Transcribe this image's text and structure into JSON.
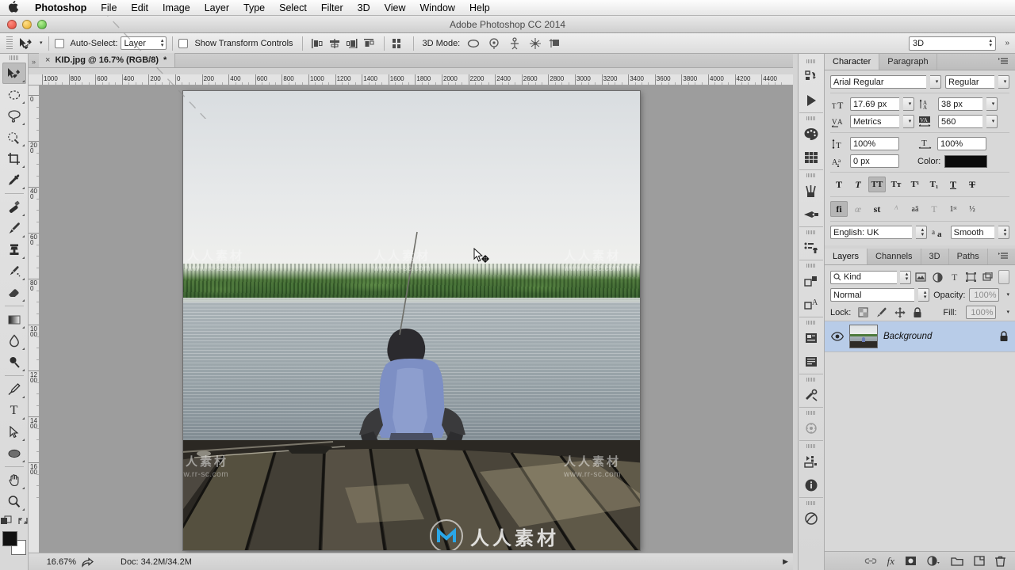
{
  "app": {
    "title": "Adobe Photoshop CC 2014"
  },
  "menubar": {
    "apple_icon": "apple-icon",
    "items": [
      {
        "label": "Photoshop",
        "bold": true
      },
      {
        "label": "File",
        "bold": false
      },
      {
        "label": "Edit",
        "bold": false
      },
      {
        "label": "Image",
        "bold": false
      },
      {
        "label": "Layer",
        "bold": false
      },
      {
        "label": "Type",
        "bold": false
      },
      {
        "label": "Select",
        "bold": false
      },
      {
        "label": "Filter",
        "bold": false
      },
      {
        "label": "3D",
        "bold": false
      },
      {
        "label": "View",
        "bold": false
      },
      {
        "label": "Window",
        "bold": false
      },
      {
        "label": "Help",
        "bold": false
      }
    ]
  },
  "options_bar": {
    "tool_icon": "move-tool-icon",
    "auto_select_label": "Auto-Select:",
    "auto_select_checked": false,
    "auto_select_target": "Layer",
    "show_transform_label": "Show Transform Controls",
    "show_transform_checked": false,
    "mode_3d_label": "3D Mode:",
    "workspace": "3D",
    "align_icons": [
      "align-left-edges-icon",
      "align-horizontal-centers-icon",
      "align-right-edges-icon",
      "align-top-edges-icon",
      "distribute-icon"
    ],
    "mode_3d_icons": [
      "rotate-3d-icon",
      "roll-3d-icon",
      "drag-3d-icon",
      "slide-3d-icon",
      "scale-3d-icon"
    ]
  },
  "toolbar": {
    "tools": [
      {
        "name": "move-tool",
        "icon": "move-tool-icon",
        "active": true
      },
      {
        "name": "marquee-tool",
        "icon": "elliptical-marquee-icon",
        "active": false
      },
      {
        "name": "lasso-tool",
        "icon": "lasso-icon",
        "active": false
      },
      {
        "name": "quick-selection-tool",
        "icon": "quick-selection-icon",
        "active": false
      },
      {
        "name": "crop-tool",
        "icon": "crop-icon",
        "active": false
      },
      {
        "name": "eyedropper-tool",
        "icon": "eyedropper-icon",
        "active": false
      },
      {
        "name": "healing-brush-tool",
        "icon": "healing-brush-icon",
        "active": false
      },
      {
        "name": "brush-tool",
        "icon": "brush-icon",
        "active": false
      },
      {
        "name": "clone-stamp-tool",
        "icon": "clone-stamp-icon",
        "active": false
      },
      {
        "name": "history-brush-tool",
        "icon": "history-brush-icon",
        "active": false
      },
      {
        "name": "eraser-tool",
        "icon": "eraser-icon",
        "active": false
      },
      {
        "name": "gradient-tool",
        "icon": "gradient-icon",
        "active": false
      },
      {
        "name": "blur-tool",
        "icon": "blur-droplet-icon",
        "active": false
      },
      {
        "name": "dodge-tool",
        "icon": "dodge-icon",
        "active": false
      },
      {
        "name": "pen-tool",
        "icon": "pen-icon",
        "active": false
      },
      {
        "name": "type-tool",
        "icon": "type-icon",
        "active": false
      },
      {
        "name": "path-selection-tool",
        "icon": "path-selection-arrow-icon",
        "active": false
      },
      {
        "name": "ellipse-tool",
        "icon": "ellipse-shape-icon",
        "active": false
      },
      {
        "name": "hand-tool",
        "icon": "hand-icon",
        "active": false
      },
      {
        "name": "zoom-tool",
        "icon": "magnifier-icon",
        "active": false
      }
    ],
    "foreground_color": "#111111",
    "background_color": "#ffffff"
  },
  "document": {
    "tab_label": "KID.jpg @ 16.7% (RGB/8)",
    "modified_marker": "*",
    "close_glyph": "×"
  },
  "rulers": {
    "horizontal": [
      "1000",
      "800",
      "600",
      "400",
      "200",
      "0",
      "200",
      "400",
      "600",
      "800",
      "1000",
      "1200",
      "1400",
      "1600",
      "1800",
      "2000",
      "2200",
      "2400",
      "2600",
      "2800",
      "3000",
      "3200",
      "3400",
      "3600",
      "3800",
      "4000",
      "4200",
      "4400"
    ],
    "vertical": [
      "0",
      "200",
      "400",
      "600",
      "800",
      "1000",
      "1200",
      "1400",
      "1600"
    ]
  },
  "canvas": {
    "watermark_cn": "人人素材",
    "watermark_url": "www.rr-sc.com",
    "cursor": "move-cursor"
  },
  "status_bar": {
    "zoom": "16.67%",
    "share_icon": "share-icon",
    "doc_info": "Doc: 34.2M/34.2M",
    "expand_glyph": "▶"
  },
  "rail": {
    "buttons": [
      "history-icon",
      "actions-play-icon",
      "color-palette-icon",
      "swatches-grid-icon",
      "brushes-icon",
      "brush-presets-icon",
      "clone-source-icon",
      "adjustments-icon",
      "styles-icon",
      "character-styles-icon",
      "paragraph-styles-icon",
      "tool-presets-icon",
      "3d-icon",
      "timeline-icon",
      "info-icon",
      "notes-icon"
    ]
  },
  "character_panel": {
    "tabs": [
      {
        "label": "Character",
        "active": true
      },
      {
        "label": "Paragraph",
        "active": false
      }
    ],
    "menu_icon": "panel-menu-icon",
    "font_family": "Arial Regular",
    "font_style": "Regular",
    "font_size_icon": "font-size-icon",
    "font_size": "17.69 px",
    "leading_icon": "leading-icon",
    "leading": "38 px",
    "kerning_icon": "kerning-icon",
    "kerning": "Metrics",
    "tracking_icon": "tracking-icon",
    "tracking": "560",
    "vertical_scale_icon": "vertical-scale-icon",
    "vertical_scale": "100%",
    "horizontal_scale_icon": "horizontal-scale-icon",
    "horizontal_scale": "100%",
    "baseline_icon": "baseline-shift-icon",
    "baseline_shift": "0 px",
    "color_label": "Color:",
    "text_color": "#0b0b0b",
    "style_buttons": [
      {
        "name": "faux-bold",
        "glyph": "T",
        "on": false
      },
      {
        "name": "faux-italic",
        "glyph": "T",
        "on": false
      },
      {
        "name": "all-caps",
        "glyph": "TT",
        "on": true
      },
      {
        "name": "small-caps",
        "glyph": "Tт",
        "on": false
      },
      {
        "name": "superscript",
        "glyph": "T¹",
        "on": false
      },
      {
        "name": "subscript",
        "glyph": "T₁",
        "on": false
      },
      {
        "name": "underline",
        "glyph": "T",
        "on": false
      },
      {
        "name": "strikethrough",
        "glyph": "T",
        "on": false
      }
    ],
    "opentype_buttons": [
      {
        "name": "standard-ligatures",
        "glyph": "fi",
        "on": true,
        "dim": false
      },
      {
        "name": "contextual-alternates",
        "glyph": "œ",
        "on": false,
        "dim": true
      },
      {
        "name": "discretionary-ligatures",
        "glyph": "st",
        "on": false,
        "dim": false
      },
      {
        "name": "swash",
        "glyph": "ᴬ",
        "on": false,
        "dim": true
      },
      {
        "name": "oldstyle",
        "glyph": "aā",
        "on": false,
        "dim": false
      },
      {
        "name": "titling-alternates",
        "glyph": "T",
        "on": false,
        "dim": true
      },
      {
        "name": "ordinals",
        "glyph": "1ˢᵗ",
        "on": false,
        "dim": false
      },
      {
        "name": "fractions",
        "glyph": "½",
        "on": false,
        "dim": false
      }
    ],
    "language": "English: UK",
    "antialias_icon": "anti-alias-icon",
    "antialias": "Smooth"
  },
  "layers_panel": {
    "tabs": [
      {
        "label": "Layers",
        "active": true
      },
      {
        "label": "Channels",
        "active": false
      },
      {
        "label": "3D",
        "active": false
      },
      {
        "label": "Paths",
        "active": false
      }
    ],
    "menu_icon": "panel-menu-icon",
    "filter_kind": "Kind",
    "filter_icons": [
      "filter-pixel-icon",
      "filter-adjustment-icon",
      "filter-type-icon",
      "filter-shape-icon",
      "filter-smart-object-icon"
    ],
    "filter_toggle_icon": "filter-power-icon",
    "blend_mode": "Normal",
    "opacity_label": "Opacity:",
    "opacity": "100%",
    "lock_label": "Lock:",
    "lock_icons": [
      "lock-transparent-pixels-icon",
      "lock-image-pixels-icon",
      "lock-position-icon",
      "lock-all-icon"
    ],
    "fill_label": "Fill:",
    "fill": "100%",
    "layers": [
      {
        "name": "Background",
        "visible": true,
        "locked": true,
        "visibility_icon": "eye-icon",
        "lock_icon": "lock-icon",
        "thumbnail": "layer-thumbnail"
      }
    ],
    "bottom_buttons": [
      "link-layers-icon",
      "layer-style-fx-icon",
      "add-layer-mask-icon",
      "new-adjustment-layer-icon",
      "new-group-icon",
      "new-layer-icon",
      "delete-layer-icon"
    ]
  },
  "colors": {
    "selection_blue": "#b8cce8",
    "panel_bg": "#d8d8d8",
    "chrome_bg": "#d4d4d4",
    "canvas_bg": "#9d9d9d"
  }
}
